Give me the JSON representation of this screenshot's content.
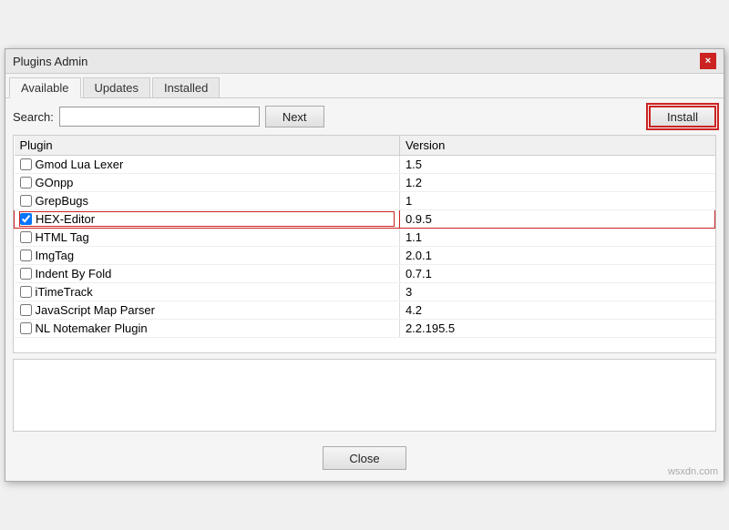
{
  "title": "Plugins Admin",
  "close_icon": "×",
  "tabs": [
    {
      "id": "available",
      "label": "Available",
      "active": true
    },
    {
      "id": "updates",
      "label": "Updates",
      "active": false
    },
    {
      "id": "installed",
      "label": "Installed",
      "active": false
    }
  ],
  "search": {
    "label": "Search:",
    "placeholder": "",
    "value": ""
  },
  "buttons": {
    "next": "Next",
    "install": "Install",
    "close": "Close"
  },
  "table": {
    "headers": [
      "Plugin",
      "Version"
    ],
    "rows": [
      {
        "name": "Gmod Lua Lexer",
        "version": "1.5",
        "checked": false,
        "highlight": false
      },
      {
        "name": "GOnpp",
        "version": "1.2",
        "checked": false,
        "highlight": false
      },
      {
        "name": "GrepBugs",
        "version": "1",
        "checked": false,
        "highlight": false
      },
      {
        "name": "HEX-Editor",
        "version": "0.9.5",
        "checked": true,
        "highlight": true
      },
      {
        "name": "HTML Tag",
        "version": "1.1",
        "checked": false,
        "highlight": false
      },
      {
        "name": "ImgTag",
        "version": "2.0.1",
        "checked": false,
        "highlight": false
      },
      {
        "name": "Indent By Fold",
        "version": "0.7.1",
        "checked": false,
        "highlight": false
      },
      {
        "name": "iTimeTrack",
        "version": "3",
        "checked": false,
        "highlight": false
      },
      {
        "name": "JavaScript Map Parser",
        "version": "4.2",
        "checked": false,
        "highlight": false
      },
      {
        "name": "NL Notemaker Plugin",
        "version": "2.2.195.5",
        "checked": false,
        "highlight": false
      }
    ]
  },
  "description": "",
  "watermark": "wsxdn.com"
}
